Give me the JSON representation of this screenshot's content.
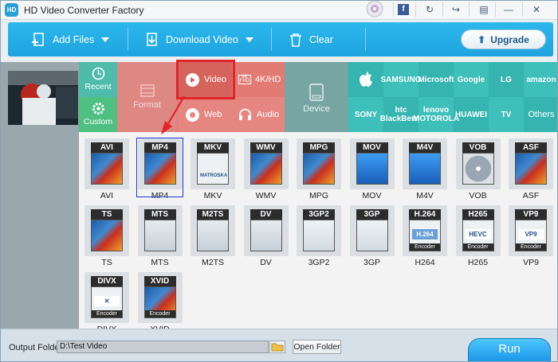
{
  "app": {
    "title": "HD Video Converter Factory",
    "logo_text": "HD"
  },
  "titlebar_buttons": [
    {
      "name": "facebook-icon",
      "glyph": "f"
    },
    {
      "name": "refresh-icon",
      "glyph": "↻"
    },
    {
      "name": "share-icon",
      "glyph": "↪"
    },
    {
      "name": "chat-icon",
      "glyph": "▤"
    },
    {
      "name": "minimize-icon",
      "glyph": "—"
    },
    {
      "name": "close-icon",
      "glyph": "✕"
    }
  ],
  "toolbar": {
    "add_files": "Add Files",
    "download_video": "Download Video",
    "clear": "Clear",
    "upgrade": "Upgrade"
  },
  "categories": {
    "recent": "Recent",
    "custom": "Custom",
    "format": "Format",
    "video": "Video",
    "k4hd": "4K/HD",
    "web": "Web",
    "audio": "Audio",
    "device": "Device"
  },
  "brands": [
    "SAMSUNG",
    "Microsoft",
    "Google",
    "LG",
    "amazon",
    "SONY",
    "htc BlackBerry",
    "lenovo MOTOROLA",
    "HUAWEI",
    "TV",
    "Others"
  ],
  "formats": [
    {
      "badge": "AVI",
      "label": "AVI",
      "art": "film"
    },
    {
      "badge": "MP4",
      "label": "MP4",
      "art": "film"
    },
    {
      "badge": "MKV",
      "label": "MKV",
      "art": "encoder",
      "sub": "MATROSKA"
    },
    {
      "badge": "WMV",
      "label": "WMV",
      "art": "film"
    },
    {
      "badge": "MPG",
      "label": "MPG",
      "art": "film"
    },
    {
      "badge": "MOV",
      "label": "MOV",
      "art": "blue"
    },
    {
      "badge": "M4V",
      "label": "M4V",
      "art": "blue"
    },
    {
      "badge": "VOB",
      "label": "VOB",
      "art": "disc"
    },
    {
      "badge": "ASF",
      "label": "ASF",
      "art": "film"
    },
    {
      "badge": "TS",
      "label": "TS",
      "art": "film"
    },
    {
      "badge": "MTS",
      "label": "MTS",
      "art": "cam"
    },
    {
      "badge": "M2TS",
      "label": "M2TS",
      "art": "cam"
    },
    {
      "badge": "DV",
      "label": "DV",
      "art": "cam"
    },
    {
      "badge": "3GP2",
      "label": "3GP2",
      "art": "phone"
    },
    {
      "badge": "3GP",
      "label": "3GP",
      "art": "phone"
    },
    {
      "badge": "H.264",
      "label": "H264",
      "art": "encoder",
      "sub": "H.264",
      "foot": "Encoder"
    },
    {
      "badge": "H265",
      "label": "H265",
      "art": "encoder",
      "sub": "HEVC",
      "foot": "Encoder"
    },
    {
      "badge": "VP9",
      "label": "VP9",
      "art": "encoder",
      "sub": "VP9",
      "foot": "Encoder"
    },
    {
      "badge": "DIVX",
      "label": "DIVX",
      "art": "encoder",
      "sub": "✕",
      "foot": "Encoder"
    },
    {
      "badge": "XVID",
      "label": "XVID",
      "art": "film",
      "foot": "Encoder"
    }
  ],
  "bottom": {
    "output_label": "Output Folder:",
    "output_path": "D:\\Test Video",
    "open_folder": "Open Folder",
    "run": "Run"
  },
  "colors": {
    "toolbar": "#1fa3df",
    "video_cell": "#d6645d",
    "brands": "#36b4b0",
    "run": "#1c97e8",
    "highlight": "#e0242a",
    "selection": "#2338c8"
  }
}
